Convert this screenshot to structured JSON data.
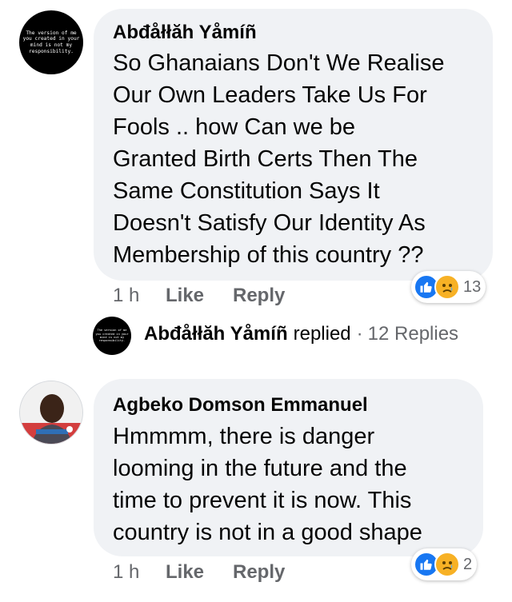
{
  "comments": [
    {
      "author": "Abđåłłăh Yåmíñ",
      "avatar_text": [
        "The version of me",
        "you created in your",
        "mind is not my",
        "responsibility."
      ],
      "body": "So Ghanaians Don't We Realise\nOur Own Leaders Take Us For\nFools .. how Can we be\nGranted Birth Certs Then The\nSame Constitution Says It\nDoesn't Satisfy Our Identity As\nMembership of this country ??",
      "time": "1 h",
      "like_label": "Like",
      "reply_label": "Reply",
      "reaction_count": "13",
      "reactions": [
        "like-icon",
        "sad-icon"
      ]
    },
    {
      "author": "Agbeko Domson Emmanuel",
      "body": "Hmmmm, there is danger\nlooming in the future and the\ntime to prevent it is now. This\ncountry is not in a good shape",
      "time": "1 h",
      "like_label": "Like",
      "reply_label": "Reply",
      "reaction_count": "2",
      "reactions": [
        "like-icon",
        "sad-icon"
      ]
    }
  ],
  "replies_summary": {
    "name": "Abđåłłăh Yåmíñ",
    "action": "replied",
    "separator": "·",
    "count_label": "12 Replies",
    "avatar_text": [
      "The version of me",
      "you created in your",
      "mind is not my",
      "responsibility."
    ]
  },
  "colors": {
    "like_blue": "#1877f2",
    "sad_yellow": "#f7b125",
    "meta_gray": "#65676b",
    "bubble_gray": "#f0f2f5"
  }
}
